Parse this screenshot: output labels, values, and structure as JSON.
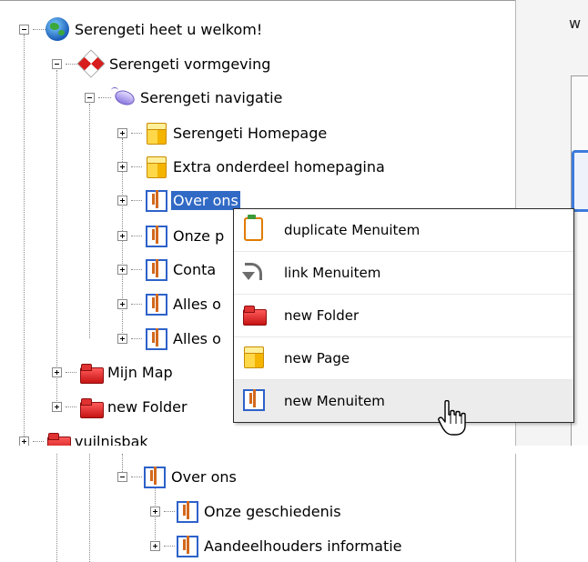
{
  "tree": {
    "root": {
      "label": "Serengeti heet u welkom!",
      "icon": "globe-icon"
    },
    "vormgeving": {
      "label": "Serengeti vormgeving",
      "icon": "checker-icon"
    },
    "navigatie": {
      "label": "Serengeti navigatie",
      "icon": "mouse-icon"
    },
    "items": [
      {
        "label": "Serengeti Homepage",
        "icon": "page-icon"
      },
      {
        "label": "Extra onderdeel homepagina",
        "icon": "page-icon"
      },
      {
        "label": "Over ons",
        "icon": "menuitem-icon",
        "selected": true
      },
      {
        "label": "Onze p",
        "icon": "menuitem-icon"
      },
      {
        "label": "Conta",
        "icon": "menuitem-icon"
      },
      {
        "label": "Alles o",
        "icon": "menuitem-icon"
      },
      {
        "label": "Alles o",
        "icon": "menuitem-icon"
      }
    ],
    "mijn_map": {
      "label": "Mijn Map",
      "icon": "folder-icon"
    },
    "new_folder": {
      "label": "new Folder",
      "icon": "folder-icon"
    },
    "vuilnisbak": {
      "label": "vuilnisbak",
      "icon": "folder-icon"
    }
  },
  "right_panel": {
    "text": "w"
  },
  "context_menu": {
    "items": [
      {
        "label": "duplicate Menuitem",
        "icon": "duplicate-icon"
      },
      {
        "label": "link Menuitem",
        "icon": "link-arrow-icon"
      },
      {
        "label": "new Folder",
        "icon": "folder-icon"
      },
      {
        "label": "new Page",
        "icon": "page-icon"
      },
      {
        "label": "new Menuitem",
        "icon": "menuitem-icon"
      }
    ]
  },
  "bottom_tree": {
    "parent": {
      "label": "Over ons",
      "icon": "menuitem-icon"
    },
    "children": [
      {
        "label": "Onze geschiedenis",
        "icon": "menuitem-icon"
      },
      {
        "label": "Aandeelhouders informatie",
        "icon": "menuitem-icon"
      }
    ]
  },
  "colors": {
    "selection": "#316ac5",
    "menu_hover": "#ececec",
    "menuitem_border": "#2d62c9",
    "folder": "#d71d1d"
  }
}
